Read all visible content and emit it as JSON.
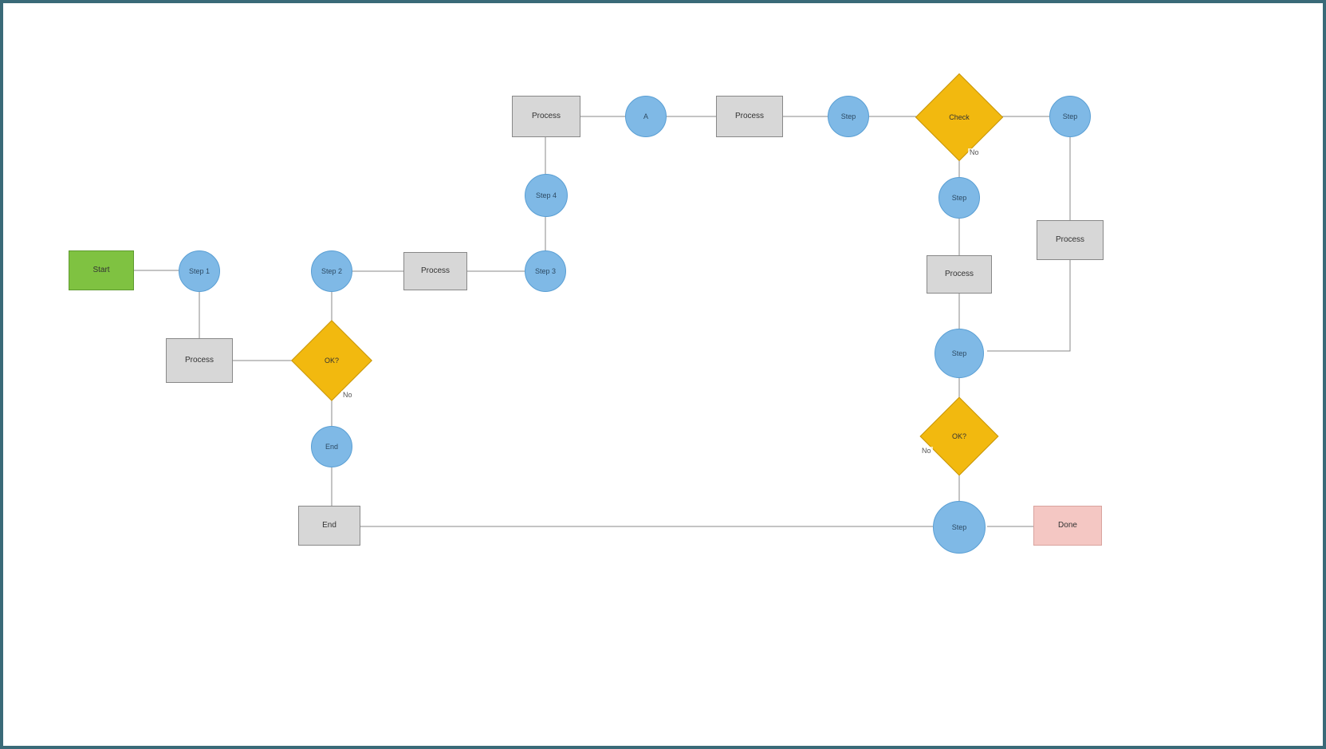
{
  "diagram": {
    "type": "flowchart",
    "nodes": {
      "start": {
        "label": "Start"
      },
      "c1": {
        "label": "Step 1"
      },
      "r1": {
        "label": "Process"
      },
      "d1": {
        "label": "OK?"
      },
      "d1_no": {
        "label": "No"
      },
      "c2": {
        "label": "Step 2"
      },
      "r2": {
        "label": "Process"
      },
      "c3": {
        "label": "Step 3"
      },
      "c4": {
        "label": "Step 4"
      },
      "r3": {
        "label": "Process"
      },
      "c5": {
        "label": "A"
      },
      "r4": {
        "label": "Process"
      },
      "c6": {
        "label": "Step"
      },
      "d2": {
        "label": "Check"
      },
      "d2_no": {
        "label": "No"
      },
      "c7": {
        "label": "Step"
      },
      "r5": {
        "label": "Process"
      },
      "c8": {
        "label": "Step"
      },
      "r6": {
        "label": "Process"
      },
      "c9": {
        "label": "Step"
      },
      "d3": {
        "label": "OK?"
      },
      "d3_no": {
        "label": "No"
      },
      "c10": {
        "label": "End"
      },
      "c11": {
        "label": "Step"
      },
      "r7": {
        "label": "End"
      },
      "end": {
        "label": "Done"
      }
    }
  }
}
